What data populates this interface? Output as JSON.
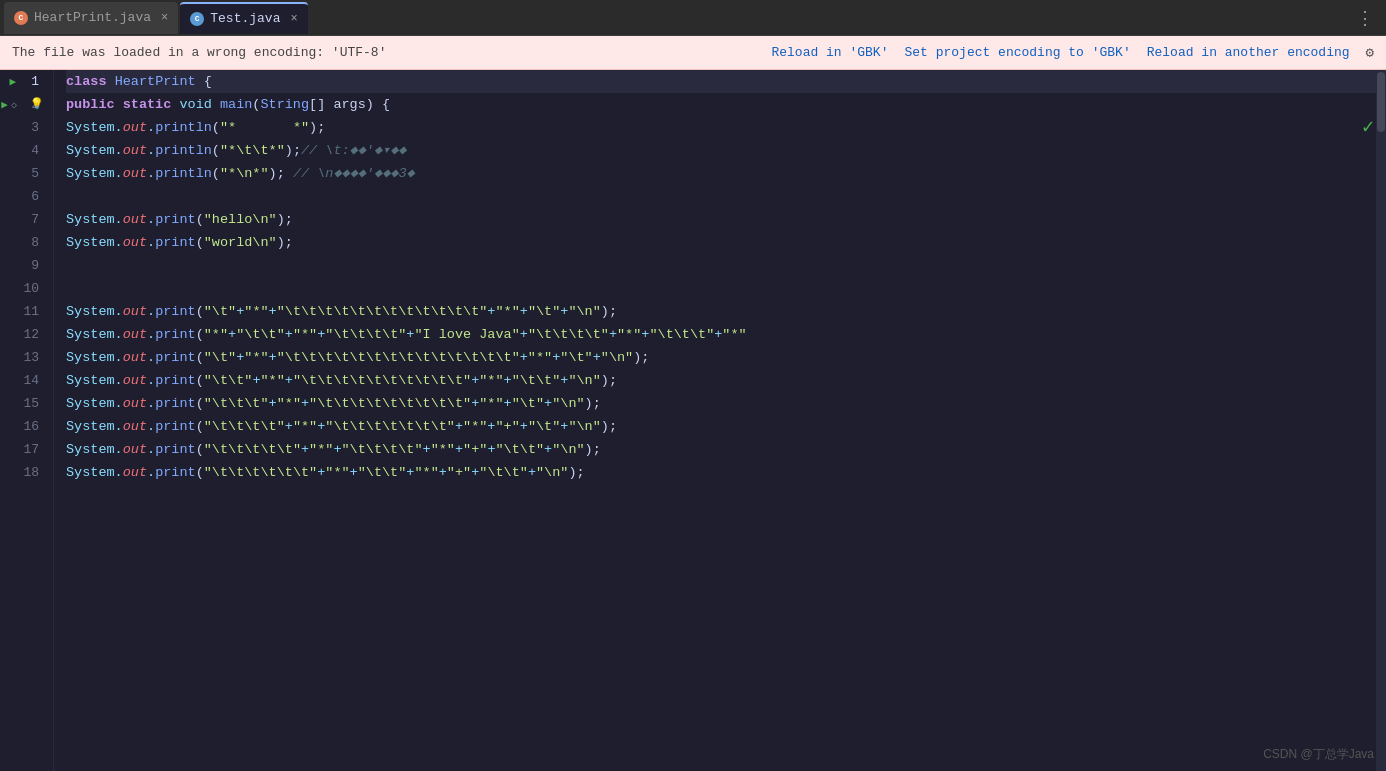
{
  "tabs": [
    {
      "id": "heartprint",
      "label": "HeartPrint.java",
      "icon": "java-icon",
      "active": false,
      "closeable": true
    },
    {
      "id": "test",
      "label": "Test.java",
      "icon": "java-icon-blue",
      "active": true,
      "closeable": true
    }
  ],
  "warning_bar": {
    "text": "The file was loaded in a wrong encoding: 'UTF-8'",
    "action1": "Reload in 'GBK'",
    "action2": "Set project encoding to 'GBK'",
    "action3": "Reload in another encoding"
  },
  "code": {
    "lines": [
      {
        "num": 1,
        "has_run": true,
        "content_html": "<span class='kw'>class</span> <span class='cls'>HeartPrint</span> <span class='plain'>{</span>"
      },
      {
        "num": 2,
        "has_run": true,
        "has_bookmark": true,
        "has_bulb": true,
        "content_html": "    <span class='kw'>public</span> <span class='kw'>static</span> <span class='kw2'>void</span> <span class='method'>main</span><span class='plain'>(</span><span class='cls'>String</span><span class='plain'>[]</span> <span class='plain'>args)</span> <span class='plain'>{</span>"
      },
      {
        "num": 3,
        "content_html": "        <span class='obj'>System</span><span class='punct'>.</span><span class='field'>out</span><span class='punct'>.</span><span class='method'>println</span><span class='plain'>(</span><span class='str'>\"*&nbsp;&nbsp;&nbsp;&nbsp;&nbsp;&nbsp;&nbsp;*\"</span><span class='plain'>);</span>"
      },
      {
        "num": 4,
        "content_html": "        <span class='obj'>System</span><span class='punct'>.</span><span class='field'>out</span><span class='punct'>.</span><span class='method'>println</span><span class='plain'>(</span><span class='str'>\"*\\t\\t*\"</span><span class='plain'>);</span><span class='cmt'>// \\t:&#x25C6;&#x25C6;'&#x25C6;&#x25BE;&#x25C6;&#x25C6;</span>"
      },
      {
        "num": 5,
        "content_html": "        <span class='obj'>System</span><span class='punct'>.</span><span class='field'>out</span><span class='punct'>.</span><span class='method'>println</span><span class='plain'>(</span><span class='str'>\"*\\n*\"</span><span class='plain'>);</span> <span class='cmt'>// \\n&#x25C6;&#x25C6;&#x25C6;&#x25C6;'&#x25C6;&#x25C6;&#x25C6;3&#x25C6;</span>"
      },
      {
        "num": 6,
        "content_html": ""
      },
      {
        "num": 7,
        "content_html": "        <span class='obj'>System</span><span class='punct'>.</span><span class='field'>out</span><span class='punct'>.</span><span class='method'>print</span><span class='plain'>(</span><span class='str'>\"hello\\n\"</span><span class='plain'>);</span>"
      },
      {
        "num": 8,
        "content_html": "        <span class='obj'>System</span><span class='punct'>.</span><span class='field'>out</span><span class='punct'>.</span><span class='method'>print</span><span class='plain'>(</span><span class='str'>\"world\\n\"</span><span class='plain'>);</span>"
      },
      {
        "num": 9,
        "content_html": ""
      },
      {
        "num": 10,
        "content_html": ""
      },
      {
        "num": 11,
        "content_html": "        <span class='obj'>System</span><span class='punct'>.</span><span class='field'>out</span><span class='punct'>.</span><span class='method'>print</span><span class='plain'>(</span><span class='str'>\"\\t\"</span><span class='concat'>+</span><span class='str'>\"*\"</span><span class='concat'>+</span><span class='str'>\"\\t\\t\\t\\t\\t\\t\\t\\t\\t\\t\\t\\t\"</span><span class='concat'>+</span><span class='str'>\"*\"</span><span class='concat'>+</span><span class='str'>\"\\t\"</span><span class='concat'>+</span><span class='str'>\"\\n\"</span><span class='plain'>);</span>"
      },
      {
        "num": 12,
        "content_html": "        <span class='obj'>System</span><span class='punct'>.</span><span class='field'>out</span><span class='punct'>.</span><span class='method'>print</span><span class='plain'>(</span><span class='str'>\"*\"</span><span class='concat'>+</span><span class='str'>\"\\t\\t\"</span><span class='concat'>+</span><span class='str'>\"*\"</span><span class='concat'>+</span><span class='str'>\"\\t\\t\\t\\t\"</span><span class='concat'>+</span><span class='str'>\"I love Java\"</span><span class='concat'>+</span><span class='str'>\"\\t\\t\\t\\t\"</span><span class='concat'>+</span><span class='str'>\"*\"</span><span class='concat'>+</span><span class='str'>\"\\t\\t\\t\"</span><span class='concat'>+</span><span class='str'>\"*\"</span>"
      },
      {
        "num": 13,
        "content_html": "        <span class='obj'>System</span><span class='punct'>.</span><span class='field'>out</span><span class='punct'>.</span><span class='method'>print</span><span class='plain'>(</span><span class='str'>\"\\t\"</span><span class='concat'>+</span><span class='str'>\"*\"</span><span class='concat'>+</span><span class='str'>\"\\t\\t\\t\\t\\t\\t\\t\\t\\t\\t\\t\\t\\t\\t\"</span><span class='concat'>+</span><span class='str'>\"*\"</span><span class='concat'>+</span><span class='str'>\"\\t\"</span><span class='concat'>+</span><span class='str'>\"\\n\"</span><span class='plain'>);</span>"
      },
      {
        "num": 14,
        "content_html": "        <span class='obj'>System</span><span class='punct'>.</span><span class='field'>out</span><span class='punct'>.</span><span class='method'>print</span><span class='plain'>(</span><span class='str'>\"\\t\\t\"</span><span class='concat'>+</span><span class='str'>\"*\"</span><span class='concat'>+</span><span class='str'>\"\\t\\t\\t\\t\\t\\t\\t\\t\\t\\t\"</span><span class='concat'>+</span><span class='str'>\"*\"</span><span class='concat'>+</span><span class='str'>\"\\t\\t\"</span><span class='concat'>+</span><span class='str'>\"\\n\"</span><span class='plain'>);</span>"
      },
      {
        "num": 15,
        "content_html": "        <span class='obj'>System</span><span class='punct'>.</span><span class='field'>out</span><span class='punct'>.</span><span class='method'>print</span><span class='plain'>(</span><span class='str'>\"\\t\\t\\t\"</span><span class='concat'>+</span><span class='str'>\"*\"</span><span class='concat'>+</span><span class='str'>\"\\t\\t\\t\\t\\t\\t\\t\\t\\t\"</span><span class='concat'>+</span><span class='str'>\"*\"</span><span class='concat'>+</span><span class='str'>\"\\t\"</span><span class='concat'>+</span><span class='str'>\"\\n\"</span><span class='plain'>);</span>"
      },
      {
        "num": 16,
        "content_html": "        <span class='obj'>System</span><span class='punct'>.</span><span class='field'>out</span><span class='punct'>.</span><span class='method'>print</span><span class='plain'>(</span><span class='str'>\"\\t\\t\\t\\t\"</span><span class='concat'>+</span><span class='str'>\"*\"</span><span class='concat'>+</span><span class='str'>\"\\t\\t\\t\\t\\t\\t\\t\"</span><span class='concat'>+</span><span class='str'>\"*\"</span><span class='concat'>+</span><span class='str'>\"+\"</span><span class='concat'>+</span><span class='str'>\"\\t\"</span><span class='concat'>+</span><span class='str'>\"\\n\"</span><span class='plain'>);</span>"
      },
      {
        "num": 17,
        "content_html": "        <span class='obj'>System</span><span class='punct'>.</span><span class='field'>out</span><span class='punct'>.</span><span class='method'>print</span><span class='plain'>(</span><span class='str'>\"\\t\\t\\t\\t\\t\"</span><span class='concat'>+</span><span class='str'>\"*\"</span><span class='concat'>+</span><span class='str'>\"\\t\\t\\t\\t\"</span><span class='concat'>+</span><span class='str'>\"*\"</span><span class='concat'>+</span><span class='str'>\"+\"</span><span class='concat'>+</span><span class='str'>\"\\t\\t\"</span><span class='concat'>+</span><span class='str'>\"\\n\"</span><span class='plain'>);</span>"
      },
      {
        "num": 18,
        "content_html": "        <span class='obj'>System</span><span class='punct'>.</span><span class='field'>out</span><span class='punct'>.</span><span class='method'>print</span><span class='plain'>(</span><span class='str'>\"\\t\\t\\t\\t\\t\\t\"</span><span class='concat'>+</span><span class='str'>\"*\"</span><span class='concat'>+</span><span class='str'>\"\\t\\t\"</span><span class='concat'>+</span><span class='str'>\"*\"</span><span class='concat'>+</span><span class='str'>\"+\"</span><span class='concat'>+</span><span class='str'>\"\\t\\t\"</span><span class='concat'>+</span><span class='str'>\"\\n\"</span><span class='plain'>);</span>"
      }
    ]
  },
  "watermark": "CSDN @丁总学Java",
  "icons": {
    "more_icon": "⋮",
    "gear_icon": "⚙",
    "check_icon": "✓",
    "run_icon": "▶",
    "bulb_icon": "●",
    "bookmark_icon": "◇",
    "close_icon": "×"
  }
}
